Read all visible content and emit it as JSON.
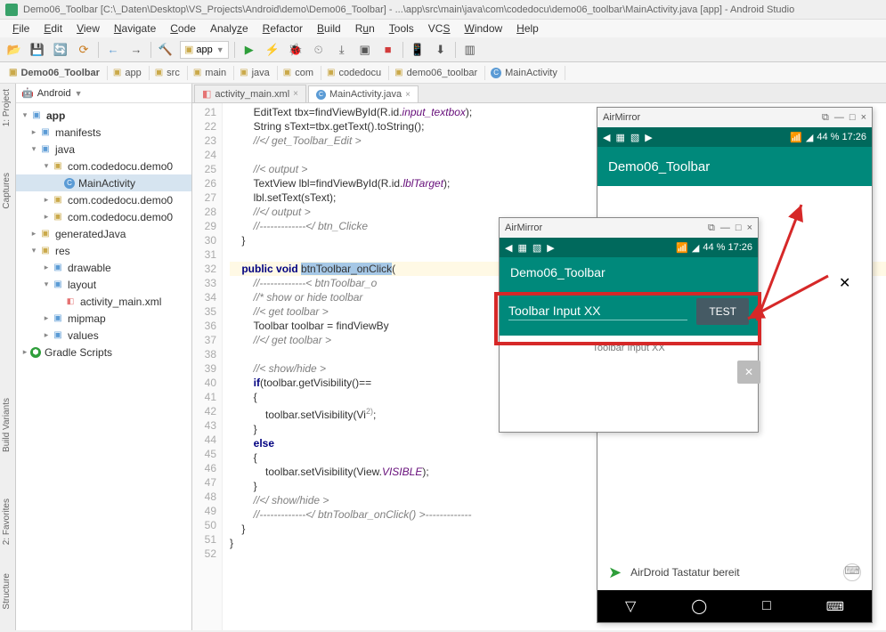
{
  "window": {
    "title": "Demo06_Toolbar [C:\\_Daten\\Desktop\\VS_Projects\\Android\\demo\\Demo06_Toolbar] - ...\\app\\src\\main\\java\\com\\codedocu\\demo06_toolbar\\MainActivity.java [app] - Android Studio"
  },
  "menu": {
    "file": "File",
    "edit": "Edit",
    "view": "View",
    "navigate": "Navigate",
    "code": "Code",
    "analyze": "Analyze",
    "refactor": "Refactor",
    "build": "Build",
    "run": "Run",
    "tools": "Tools",
    "vcs": "VCS",
    "window": "Window",
    "help": "Help"
  },
  "toolbar": {
    "combo": "app"
  },
  "breadcrumb": [
    "Demo06_Toolbar",
    "app",
    "src",
    "main",
    "java",
    "com",
    "codedocu",
    "demo06_toolbar",
    "MainActivity"
  ],
  "project": {
    "header": "Android",
    "tree": {
      "app": "app",
      "manifests": "manifests",
      "java": "java",
      "pkg1": "com.codedocu.demo0",
      "mainactivity": "MainActivity",
      "pkg2": "com.codedocu.demo0",
      "pkg3": "com.codedocu.demo0",
      "genjava": "generatedJava",
      "res": "res",
      "drawable": "drawable",
      "layout": "layout",
      "activity_main": "activity_main.xml",
      "mipmap": "mipmap",
      "values": "values",
      "gradle": "Gradle Scripts"
    }
  },
  "tabs": {
    "tab1": "activity_main.xml",
    "tab2": "MainActivity.java"
  },
  "code": {
    "lines": [
      "21",
      "22",
      "23",
      "24",
      "25",
      "26",
      "27",
      "28",
      "29",
      "30",
      "31",
      "32",
      "33",
      "34",
      "35",
      "36",
      "37",
      "38",
      "39",
      "40",
      "41",
      "42",
      "43",
      "44",
      "45",
      "46",
      "47",
      "48",
      "49",
      "50",
      "51",
      "52"
    ]
  },
  "emu1": {
    "title": "AirMirror",
    "status_right": "44 %  17:26",
    "app_title": "Demo06_Toolbar"
  },
  "emu2": {
    "title": "AirMirror",
    "status_right": "44 %  17:26",
    "app_title": "Demo06_Toolbar",
    "input": "Toolbar Input XX",
    "btn": "TEST",
    "below": "Toolbar Input XX",
    "airdroid": "AirDroid Tastatur bereit"
  },
  "sidebar": {
    "project": "1: Project",
    "captures": "Captures",
    "build_variants": "Build Variants",
    "favorites": "2: Favorites",
    "structure": "Structure"
  }
}
